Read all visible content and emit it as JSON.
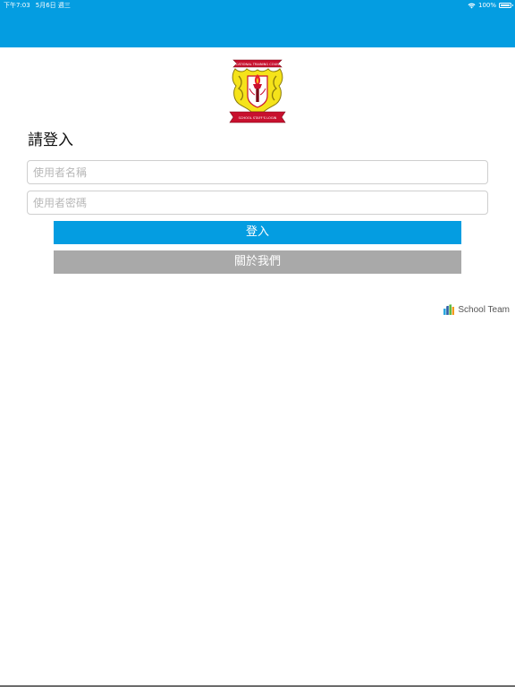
{
  "status_bar": {
    "time": "下午7:03",
    "date": "5月6日 週三",
    "battery_percent": "100%",
    "icons": [
      "wifi-icon",
      "battery-icon"
    ]
  },
  "header": {
    "color": "#049de1"
  },
  "logo": {
    "icon": "school-crest-icon",
    "banner_top_text": "VOCATIONAL TRAINING COUNCIL",
    "banner_bottom_text": "SCHOOL STAFF'S LOGIN"
  },
  "login": {
    "title": "請登入",
    "username_placeholder": "使用者名稱",
    "username_value": "",
    "password_placeholder": "使用者密碼",
    "password_value": "",
    "login_button": "登入",
    "about_button": "關於我們",
    "login_button_color": "#049de1",
    "about_button_color": "#a9a9a9"
  },
  "footer": {
    "brand_icon": "school-team-logo-icon",
    "brand_text": "School Team"
  }
}
